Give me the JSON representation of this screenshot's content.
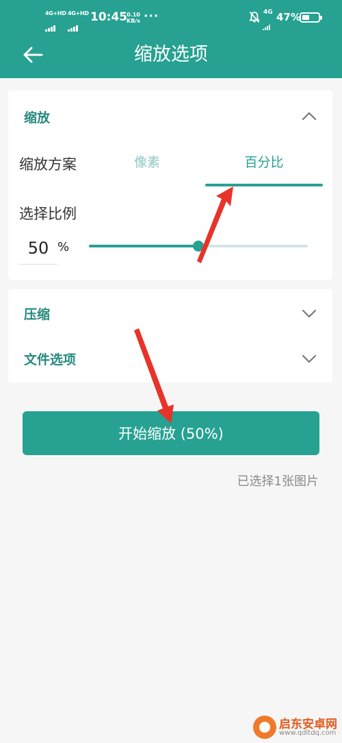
{
  "status_bar": {
    "sig1_label": "4G+HD",
    "sig2_label": "4G+HD",
    "time": "10:45",
    "speed_value": "0.10",
    "speed_unit": "KB/s",
    "dots": "···",
    "net4g": "4G",
    "battery": "47%",
    "battery_level": 0.47
  },
  "header": {
    "title": "缩放选项",
    "back_icon": "arrow-left-icon"
  },
  "zoom_section": {
    "title": "缩放",
    "scheme_label": "缩放方案",
    "tabs": [
      "像素",
      "百分比"
    ],
    "selected_tab": "百分比",
    "ratio_label": "选择比例",
    "ratio_value": "50",
    "ratio_unit": "%",
    "slider_fraction": 0.5
  },
  "compress_section": {
    "title": "压缩"
  },
  "file_options_section": {
    "title": "文件选项"
  },
  "start_button": {
    "label": "开始缩放 (50%)"
  },
  "selection_info": "已选择1张图片",
  "watermark": {
    "name": "启东安卓网",
    "url": "www.qdltdq.com"
  },
  "colors": {
    "primary": "#26a192",
    "section_title": "#26897d",
    "background": "#f6f6f6",
    "annotation_arrow": "#e8332a"
  }
}
